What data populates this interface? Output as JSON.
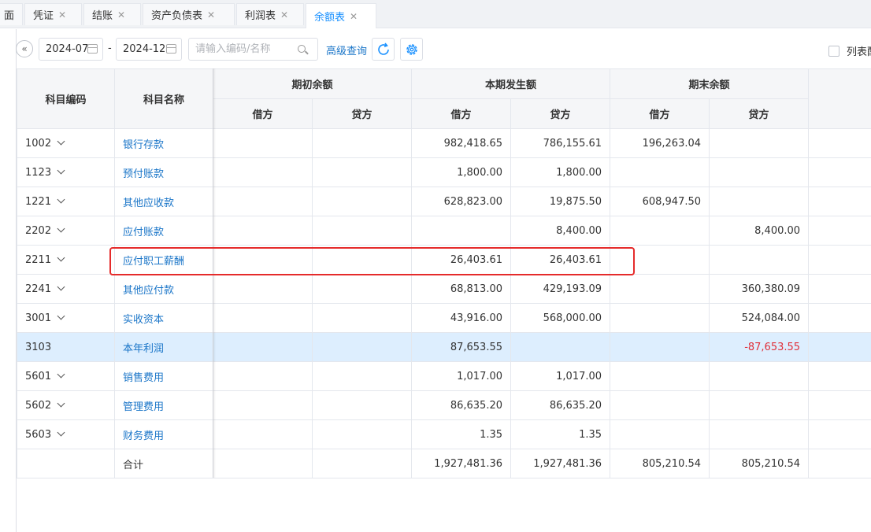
{
  "tabs": [
    {
      "label": "面",
      "closable": false
    },
    {
      "label": "凭证",
      "closable": true
    },
    {
      "label": "结账",
      "closable": true
    },
    {
      "label": "资产负债表",
      "closable": true
    },
    {
      "label": "利润表",
      "closable": true
    },
    {
      "label": "余额表",
      "closable": true,
      "active": true
    }
  ],
  "toolbar": {
    "collapse_icon": "«",
    "date_from": "2024-07",
    "date_separator": "-",
    "date_to": "2024-12",
    "search_placeholder": "请输入编码/名称",
    "advanced_query": "高级查询",
    "list_config_label": "列表配置"
  },
  "table": {
    "headers": {
      "code": "科目编码",
      "name": "科目名称",
      "opening": "期初余额",
      "period": "本期发生额",
      "closing": "期末余额",
      "debit": "借方",
      "credit": "贷方"
    },
    "rows": [
      {
        "code": "1002",
        "expand": true,
        "name": "银行存款",
        "open_debit": "",
        "open_credit": "",
        "period_debit": "982,418.65",
        "period_credit": "786,155.61",
        "close_debit": "196,263.04",
        "close_credit": ""
      },
      {
        "code": "1123",
        "expand": true,
        "name": "预付账款",
        "open_debit": "",
        "open_credit": "",
        "period_debit": "1,800.00",
        "period_credit": "1,800.00",
        "close_debit": "",
        "close_credit": ""
      },
      {
        "code": "1221",
        "expand": true,
        "name": "其他应收款",
        "open_debit": "",
        "open_credit": "",
        "period_debit": "628,823.00",
        "period_credit": "19,875.50",
        "close_debit": "608,947.50",
        "close_credit": ""
      },
      {
        "code": "2202",
        "expand": true,
        "name": "应付账款",
        "open_debit": "",
        "open_credit": "",
        "period_debit": "",
        "period_credit": "8,400.00",
        "close_debit": "",
        "close_credit": "8,400.00"
      },
      {
        "code": "2211",
        "expand": true,
        "name": "应付职工薪酬",
        "open_debit": "",
        "open_credit": "",
        "period_debit": "26,403.61",
        "period_credit": "26,403.61",
        "close_debit": "",
        "close_credit": ""
      },
      {
        "code": "2241",
        "expand": true,
        "name": "其他应付款",
        "open_debit": "",
        "open_credit": "",
        "period_debit": "68,813.00",
        "period_credit": "429,193.09",
        "close_debit": "",
        "close_credit": "360,380.09"
      },
      {
        "code": "3001",
        "expand": true,
        "name": "实收资本",
        "open_debit": "",
        "open_credit": "",
        "period_debit": "43,916.00",
        "period_credit": "568,000.00",
        "close_debit": "",
        "close_credit": "524,084.00"
      },
      {
        "code": "3103",
        "expand": false,
        "selected": true,
        "name": "本年利润",
        "open_debit": "",
        "open_credit": "",
        "period_debit": "87,653.55",
        "period_credit": "",
        "close_debit": "",
        "close_credit": "-87,653.55"
      },
      {
        "code": "5601",
        "expand": true,
        "name": "销售费用",
        "open_debit": "",
        "open_credit": "",
        "period_debit": "1,017.00",
        "period_credit": "1,017.00",
        "close_debit": "",
        "close_credit": ""
      },
      {
        "code": "5602",
        "expand": true,
        "name": "管理费用",
        "open_debit": "",
        "open_credit": "",
        "period_debit": "86,635.20",
        "period_credit": "86,635.20",
        "close_debit": "",
        "close_credit": ""
      },
      {
        "code": "5603",
        "expand": true,
        "name": "财务费用",
        "open_debit": "",
        "open_credit": "",
        "period_debit": "1.35",
        "period_credit": "1.35",
        "close_debit": "",
        "close_credit": ""
      }
    ],
    "total": {
      "label": "合计",
      "open_debit": "",
      "open_credit": "",
      "period_debit": "1,927,481.36",
      "period_credit": "1,927,481.36",
      "close_debit": "805,210.54",
      "close_credit": "805,210.54"
    }
  },
  "colors": {
    "accent": "#1890ff",
    "link": "#1a75c8",
    "negative": "#e0303a",
    "highlight": "#e52b2b",
    "selected_row": "#ddeefe"
  },
  "icons": [
    "double-chevron-left-icon",
    "calendar-icon",
    "search-icon",
    "refresh-icon",
    "gear-icon",
    "chevron-down-icon",
    "close-icon"
  ]
}
